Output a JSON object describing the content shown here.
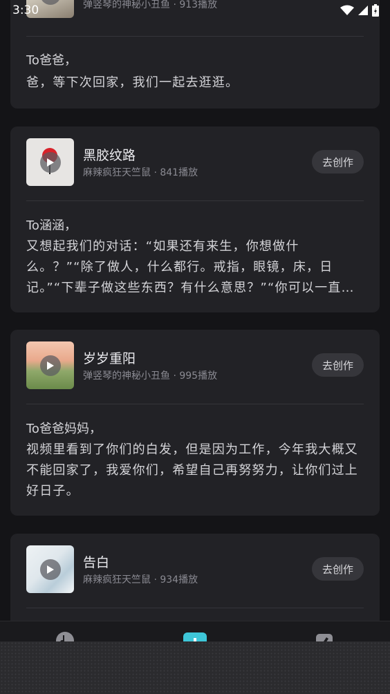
{
  "status": {
    "time": "3:30"
  },
  "button_label": "去创作",
  "cards": [
    {
      "title": "",
      "author": "弹竖琴的神秘小丑鱼",
      "plays": "913播放",
      "to": "To爸爸，",
      "message": "爸，等下次回家，我们一起去逛逛。"
    },
    {
      "title": "黑胶纹路",
      "author": "麻辣疯狂天竺鼠",
      "plays": "841播放",
      "to": "To涵涵，",
      "message": "又想起我们的对话：“如果还有来生，你想做什么。？”“除了做人，什么都行。戒指，眼镜，床，日记。”“下辈子做这些东西？有什么意思？”“你可以一直陪在我身边啊。”"
    },
    {
      "title": "岁岁重阳",
      "author": "弹竖琴的神秘小丑鱼",
      "plays": "995播放",
      "to": "To爸爸妈妈，",
      "message": "视频里看到了你们的白发，但是因为工作，今年我大概又不能回家了，我爱你们，希望自己再努努力，让你们过上好日子。"
    },
    {
      "title": "告白",
      "author": "麻辣疯狂天竺鼠",
      "plays": "934播放",
      "to": "",
      "message": ""
    }
  ],
  "meta_separator": " · ",
  "colors": {
    "background": "#141417",
    "card": "#222226",
    "button": "#36363b",
    "accent": "#3ec6d8"
  },
  "icons": [
    "wifi-icon",
    "signal-icon",
    "battery-icon",
    "play-icon",
    "music-note-icon",
    "plus-icon",
    "edit-icon"
  ]
}
